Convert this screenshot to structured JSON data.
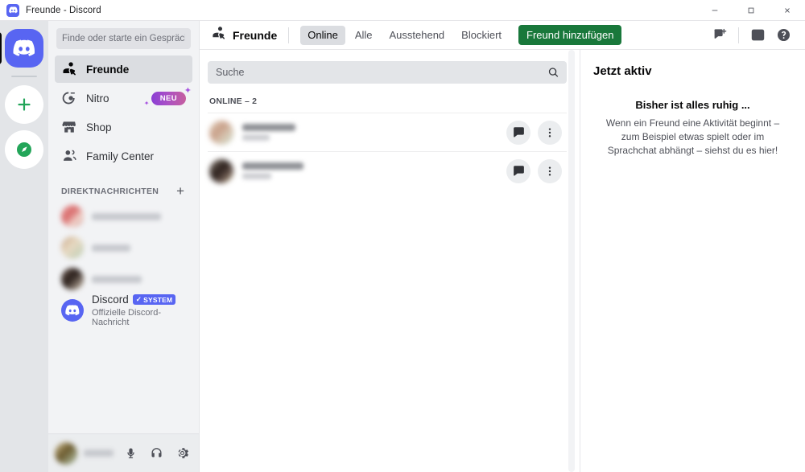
{
  "window": {
    "title": "Freunde - Discord",
    "minimize_label": "Minimieren",
    "maximize_label": "Maximieren",
    "close_label": "Schließen"
  },
  "rail": {
    "home_label": "Startseite",
    "add_server_label": "Einen Server hinzufügen",
    "explore_label": "Öffentliche Server entdecken"
  },
  "sidebar": {
    "search_placeholder": "Finde oder starte ein Gespräch",
    "search_value": "",
    "nav_items": [
      {
        "label": "Freunde",
        "icon": "friends-icon",
        "active": true
      },
      {
        "label": "Nitro",
        "icon": "nitro-icon",
        "active": false,
        "badge": "NEU"
      },
      {
        "label": "Shop",
        "icon": "shop-icon",
        "active": false
      },
      {
        "label": "Family Center",
        "icon": "family-center-icon",
        "active": false
      }
    ],
    "dm_header": "DIREKTNACHRICHTEN",
    "dm_add_label": "+",
    "dm_items": [
      {
        "redacted": true,
        "name_width": 86,
        "sub_width": 0,
        "avatar_colors": [
          "#e8a0a0",
          "#d96c6c",
          "#f0d8d0",
          "#c9736a"
        ]
      },
      {
        "redacted": true,
        "name_width": 48,
        "sub_width": 0,
        "avatar_colors": [
          "#c9a88a",
          "#b9cdb4",
          "#e7d9c2",
          "#a8c7a8"
        ]
      },
      {
        "redacted": true,
        "name_width": 62,
        "sub_width": 0,
        "avatar_colors": [
          "#4a3a33",
          "#2b201c",
          "#6d5b52",
          "#d8c8a8"
        ]
      }
    ],
    "discord_dm": {
      "name": "Discord",
      "badge": "SYSTEM",
      "subtitle": "Offizielle Discord-Nachricht"
    },
    "user_panel": {
      "name_redacted": true,
      "mic_label": "Stummschalten",
      "headset_label": "Ton aus",
      "settings_label": "Benutzereinstellungen"
    }
  },
  "topbar": {
    "friends_label": "Freunde",
    "tabs": [
      {
        "label": "Online",
        "selected": true
      },
      {
        "label": "Alle",
        "selected": false
      },
      {
        "label": "Ausstehend",
        "selected": false
      },
      {
        "label": "Blockiert",
        "selected": false
      }
    ],
    "add_friend_label": "Freund hinzufügen",
    "add_friend_color": "#19783b",
    "icons": [
      {
        "name": "new-dm-icon",
        "label": "Neue Gruppen-DM"
      },
      {
        "name": "inbox-icon",
        "label": "Posteingang"
      },
      {
        "name": "help-icon",
        "label": "Hilfe"
      }
    ]
  },
  "friends": {
    "search_placeholder": "Suche",
    "search_value": "",
    "section_label": "ONLINE – 2",
    "rows": [
      {
        "redacted": true,
        "name_width": 66,
        "sub_width": 34,
        "status": "online",
        "status_color": "#23a559",
        "avatar_colors": [
          "#e2d3c0",
          "#c9a089",
          "#d8cbb8",
          "#b9cdb4"
        ],
        "message_label": "Nachricht",
        "more_label": "Mehr"
      },
      {
        "redacted": true,
        "name_width": 76,
        "sub_width": 36,
        "status": "online",
        "status_color": "#23a559",
        "avatar_colors": [
          "#8a7d72",
          "#2b201c",
          "#6d5b52",
          "#e8d9a8"
        ],
        "message_label": "Nachricht",
        "more_label": "Mehr"
      }
    ]
  },
  "active_panel": {
    "title": "Jetzt aktiv",
    "empty_title": "Bisher ist alles ruhig ...",
    "empty_body": "Wenn ein Freund eine Aktivität beginnt – zum Beispiel etwas spielt oder im Sprachchat abhängt – siehst du es hier!"
  }
}
